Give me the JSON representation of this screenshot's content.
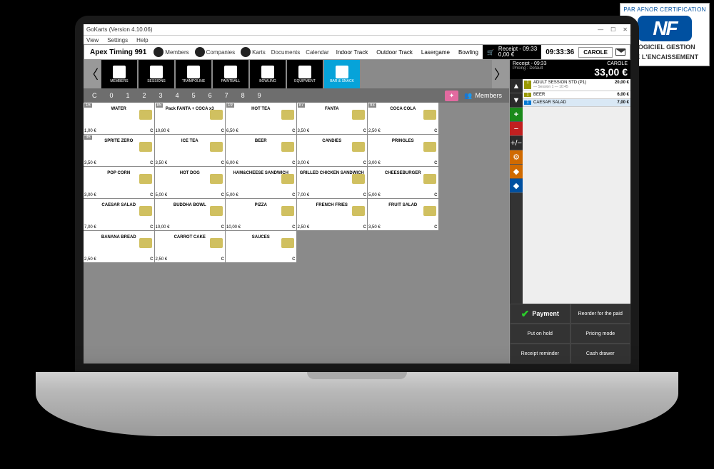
{
  "window": {
    "title": "GoKarts (Version 4.10.06)",
    "menu": [
      "View",
      "Settings",
      "Help"
    ]
  },
  "topbar": {
    "app_title": "Apex Timing 991",
    "items": [
      "Members",
      "Companies",
      "Karts",
      "Documents",
      "Calendar"
    ],
    "tracks": [
      "Indoor Track",
      "Outdoor Track",
      "Lasergame",
      "Bowling"
    ],
    "receipt_label": "Receipt - 09:33",
    "receipt_amount": "0,00 €",
    "clock": "09:33:36",
    "user_btn": "CAROLE"
  },
  "categories": [
    {
      "label": "MEMBERS"
    },
    {
      "label": "SESSIONS"
    },
    {
      "label": "TRAMPOLINE"
    },
    {
      "label": "PAINTBALL"
    },
    {
      "label": "BOWLING"
    },
    {
      "label": "EQUIPMENT"
    },
    {
      "label": "BAR & SNACK",
      "active": true
    }
  ],
  "numbers": [
    "C",
    "0",
    "1",
    "2",
    "3",
    "4",
    "5",
    "6",
    "7",
    "8",
    "9"
  ],
  "members_btn": "Members",
  "products": [
    {
      "name": "WATER",
      "price": "1,00 €",
      "tag": "16"
    },
    {
      "name": "Pack FANTA + COCA x3",
      "price": "10,80 €",
      "tag": "85"
    },
    {
      "name": "HOT TEA",
      "price": "6,50 €",
      "tag": "19"
    },
    {
      "name": "FANTA",
      "price": "3,50 €",
      "tag": "87"
    },
    {
      "name": "COCA COLA",
      "price": "2,50 €",
      "tag": "93"
    },
    {
      "name": "",
      "price": "",
      "tag": "",
      "empty": true
    },
    {
      "name": "SPRITE ZERO",
      "price": "3,50 €",
      "tag": "36"
    },
    {
      "name": "ICE TEA",
      "price": "3,50 €",
      "tag": ""
    },
    {
      "name": "BEER",
      "price": "6,00 €",
      "tag": ""
    },
    {
      "name": "CANDIES",
      "price": "3,00 €",
      "tag": ""
    },
    {
      "name": "PRINGLES",
      "price": "3,00 €",
      "tag": ""
    },
    {
      "name": "",
      "price": "",
      "tag": "",
      "empty": true
    },
    {
      "name": "POP CORN",
      "price": "3,00 €",
      "tag": ""
    },
    {
      "name": "HOT DOG",
      "price": "5,00 €",
      "tag": ""
    },
    {
      "name": "HAM&CHEESE SANDWICH",
      "price": "5,00 €",
      "tag": ""
    },
    {
      "name": "GRILLED CHICKEN SANDWICH",
      "price": "7,00 €",
      "tag": ""
    },
    {
      "name": "CHEESEBURGER",
      "price": "5,00 €",
      "tag": ""
    },
    {
      "name": "",
      "price": "",
      "tag": "",
      "empty": true
    },
    {
      "name": "CAESAR SALAD",
      "price": "7,00 €",
      "tag": ""
    },
    {
      "name": "BUDDHA BOWL",
      "price": "10,00 €",
      "tag": ""
    },
    {
      "name": "PIZZA",
      "price": "10,00 €",
      "tag": ""
    },
    {
      "name": "FRENCH FRIES",
      "price": "2,50 €",
      "tag": ""
    },
    {
      "name": "FRUIT SALAD",
      "price": "3,50 €",
      "tag": ""
    },
    {
      "name": "",
      "price": "",
      "tag": "",
      "empty": true
    },
    {
      "name": "BANANA BREAD",
      "price": "2,50 €",
      "tag": ""
    },
    {
      "name": "CARROT CAKE",
      "price": "2,50 €",
      "tag": ""
    },
    {
      "name": "SAUCES",
      "price": "",
      "tag": ""
    }
  ],
  "receipt": {
    "header_left": "Receipt - 09:33",
    "user": "CAROLE",
    "total": "33,00 €",
    "pricing": "Pricing : Default",
    "lines": [
      {
        "qty": "1",
        "desc": "ADULT SESSION STD (P1)",
        "sub": "— Session 1 — 10:45",
        "amt": "20,00 €"
      },
      {
        "qty": "1",
        "desc": "BEER",
        "sub": "",
        "amt": "6,00 €"
      },
      {
        "qty": "1",
        "desc": "CAESAR SALAD",
        "sub": "",
        "amt": "7,00 €",
        "sel": true
      }
    ]
  },
  "actions": {
    "payment": "Payment",
    "reorder": "Reorder for the paid",
    "hold": "Put on hold",
    "pricing": "Pricing mode",
    "reminder": "Receipt reminder",
    "drawer": "Cash drawer"
  },
  "nf": {
    "arc": "PAR AFNOR CERTIFICATION",
    "logo": "NF",
    "sub1": "LOGICIEL GESTION",
    "sub2": "DE L'ENCAISSEMENT"
  }
}
